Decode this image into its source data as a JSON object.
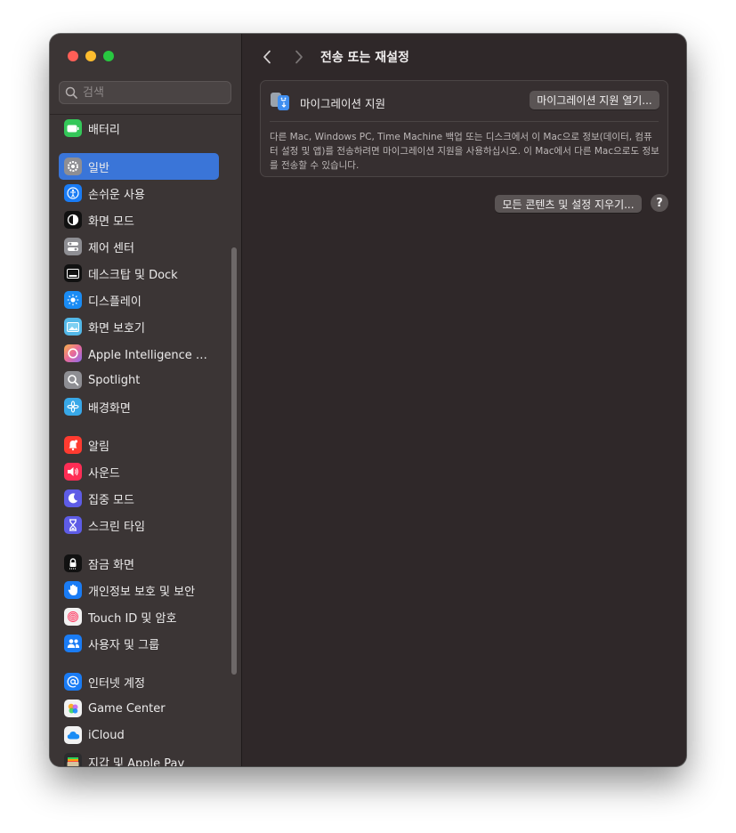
{
  "window": {
    "title": "전송 또는 재설정"
  },
  "sidebar": {
    "search_placeholder": "검색",
    "items": [
      {
        "label": "배터리",
        "icon": "battery-icon",
        "color": "#34c759"
      },
      {
        "label": "일반",
        "icon": "gear-icon",
        "color": "#8e8e93"
      },
      {
        "label": "손쉬운 사용",
        "icon": "accessibility-icon",
        "color": "#1a7cf5"
      },
      {
        "label": "화면 모드",
        "icon": "appearance-icon",
        "color": "#111111"
      },
      {
        "label": "제어 센터",
        "icon": "control-center-icon",
        "color": "#8e8e93"
      },
      {
        "label": "데스크탑 및 Dock",
        "icon": "dock-icon",
        "color": "#111111"
      },
      {
        "label": "디스플레이",
        "icon": "display-sun-icon",
        "color": "#1a8cf5"
      },
      {
        "label": "화면 보호기",
        "icon": "screensaver-icon",
        "color": "#53b8e8"
      },
      {
        "label": "Apple Intelligence 및...",
        "icon": "apple-intelligence-icon",
        "color": "#e86a9a"
      },
      {
        "label": "Spotlight",
        "icon": "spotlight-magnifier-icon",
        "color": "#8e8e93"
      },
      {
        "label": "배경화면",
        "icon": "wallpaper-flower-icon",
        "color": "#38a8e8"
      },
      {
        "label": "알림",
        "icon": "notifications-bell-icon",
        "color": "#ff3b30"
      },
      {
        "label": "사운드",
        "icon": "sound-speaker-icon",
        "color": "#ff2d55"
      },
      {
        "label": "집중 모드",
        "icon": "focus-moon-icon",
        "color": "#5e5ce6"
      },
      {
        "label": "스크린 타임",
        "icon": "screen-time-hourglass-icon",
        "color": "#5e5ce6"
      },
      {
        "label": "잠금 화면",
        "icon": "lock-screen-icon",
        "color": "#111111"
      },
      {
        "label": "개인정보 보호 및 보안",
        "icon": "privacy-hand-icon",
        "color": "#1a7cf5"
      },
      {
        "label": "Touch ID 및 암호",
        "icon": "fingerprint-icon",
        "color": "#f2f2f2"
      },
      {
        "label": "사용자 및 그룹",
        "icon": "users-group-icon",
        "color": "#1a7cf5"
      },
      {
        "label": "인터넷 계정",
        "icon": "at-sign-icon",
        "color": "#1a7cf5"
      },
      {
        "label": "Game Center",
        "icon": "game-center-icon",
        "color": "#f2f2f2"
      },
      {
        "label": "iCloud",
        "icon": "icloud-icon",
        "color": "#f2f2f2"
      },
      {
        "label": "지갑 및 Apple Pay",
        "icon": "wallet-icon",
        "color": "#2c2c2e"
      }
    ],
    "selected_color": "#3a75d8"
  },
  "main": {
    "migration": {
      "label": "마이그레이션 지원",
      "button": "마이그레이션 지원 열기...",
      "description": "다른 Mac, Windows PC, Time Machine 백업 또는 디스크에서 이 Mac으로 정보(데이터, 컴퓨터 설정 및 앱)를 전송하려면 마이그레이션 지원을 사용하십시오. 이 Mac에서 다른 Mac으로도 정보를 전송할 수 있습니다."
    },
    "erase_button": "모든 콘텐츠 및 설정 지우기...",
    "help_label": "?"
  }
}
